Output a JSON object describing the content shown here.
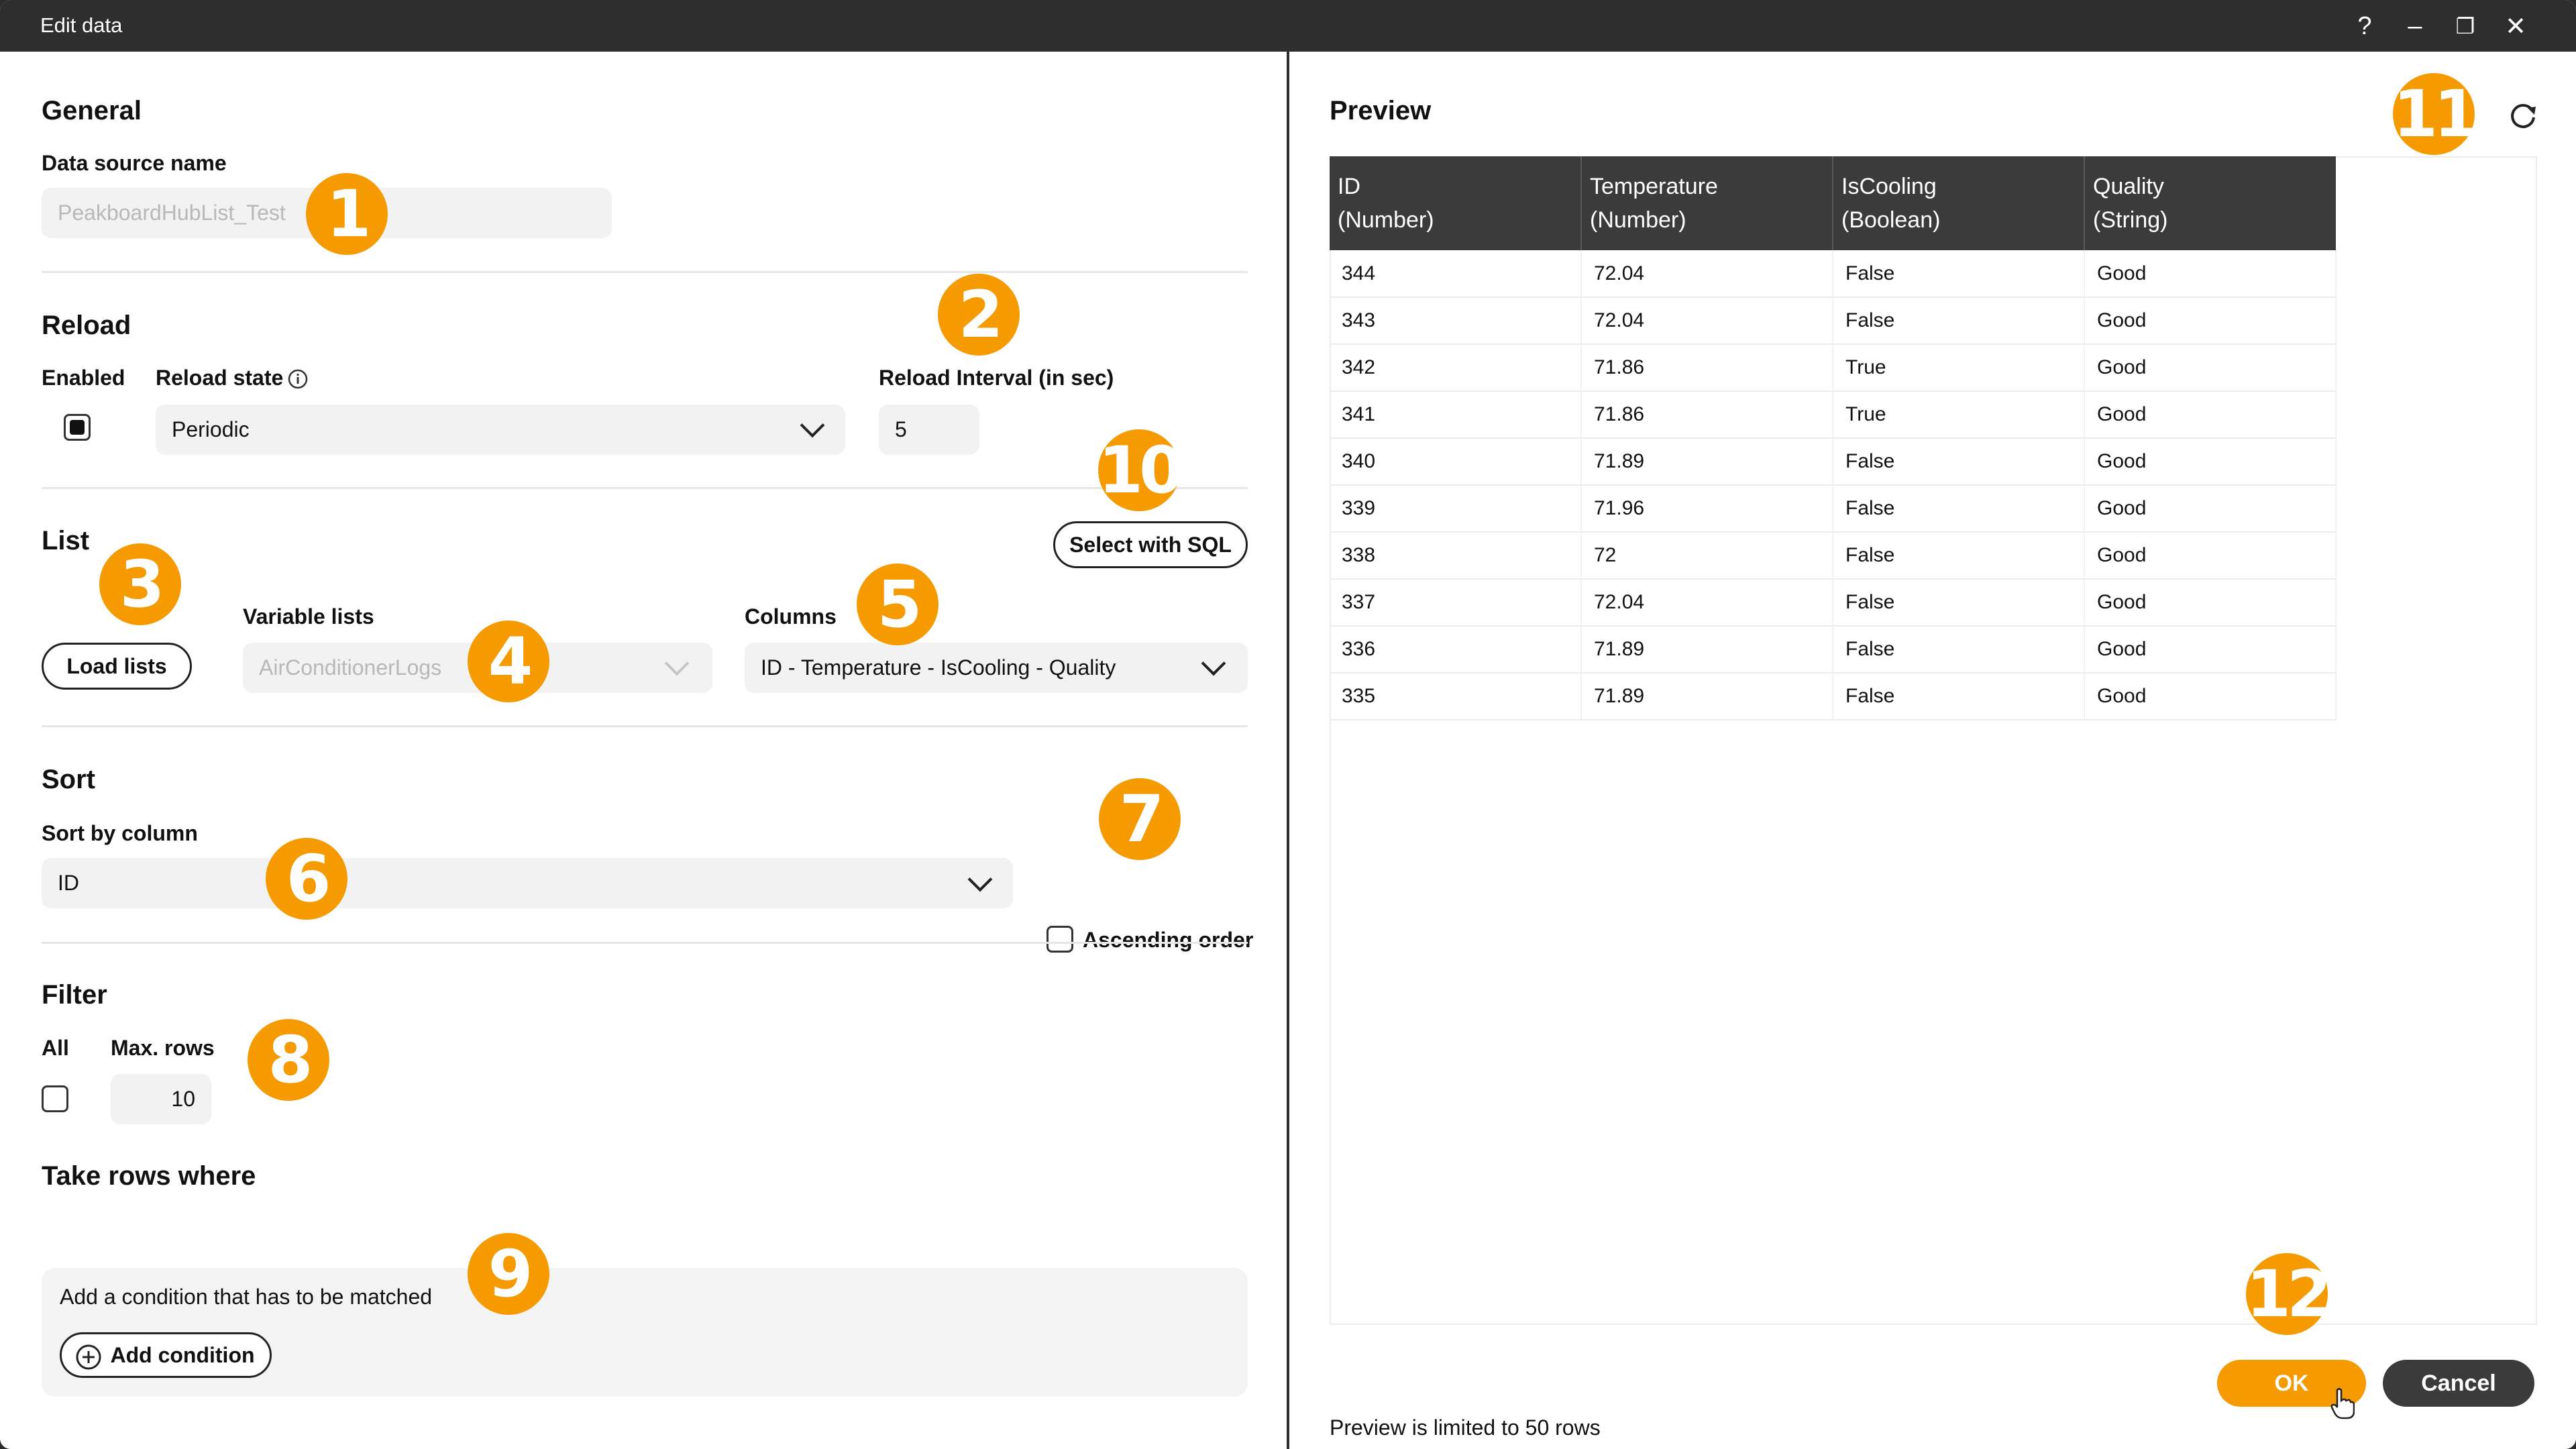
{
  "window": {
    "title": "Edit data",
    "controls": [
      "?",
      "–",
      "❐",
      "✕"
    ]
  },
  "general": {
    "heading": "General",
    "source_name_label": "Data source name",
    "source_name_value": "PeakboardHubList_Test"
  },
  "reload": {
    "heading": "Reload",
    "enabled_label": "Enabled",
    "enabled_checked": true,
    "state_label": "Reload state",
    "state_value": "Periodic",
    "interval_label": "Reload Interval (in sec)",
    "interval_value": "5"
  },
  "list": {
    "heading": "List",
    "select_sql_label": "Select with SQL",
    "load_lists_label": "Load lists",
    "variable_lists_label": "Variable lists",
    "variable_lists_value": "AirConditionerLogs",
    "columns_label": "Columns",
    "columns_value": "ID - Temperature - IsCooling - Quality"
  },
  "sort": {
    "heading": "Sort",
    "sort_by_label": "Sort by column",
    "sort_by_value": "ID",
    "ascending_label": "Ascending order",
    "ascending_checked": false
  },
  "filter": {
    "heading": "Filter",
    "all_label": "All",
    "all_checked": false,
    "max_rows_label": "Max. rows",
    "max_rows_value": "10"
  },
  "conditions": {
    "heading": "Take rows where",
    "hint": "Add a condition that has to be matched",
    "add_label": "Add condition"
  },
  "preview": {
    "heading": "Preview",
    "columns": [
      "ID\n(Number)",
      "Temperature\n(Number)",
      "IsCooling\n(Boolean)",
      "Quality\n(String)"
    ],
    "rows": [
      [
        "344",
        "72.04",
        "False",
        "Good"
      ],
      [
        "343",
        "72.04",
        "False",
        "Good"
      ],
      [
        "342",
        "71.86",
        "True",
        "Good"
      ],
      [
        "341",
        "71.86",
        "True",
        "Good"
      ],
      [
        "340",
        "71.89",
        "False",
        "Good"
      ],
      [
        "339",
        "71.96",
        "False",
        "Good"
      ],
      [
        "338",
        "72",
        "False",
        "Good"
      ],
      [
        "337",
        "72.04",
        "False",
        "Good"
      ],
      [
        "336",
        "71.89",
        "False",
        "Good"
      ],
      [
        "335",
        "71.89",
        "False",
        "Good"
      ]
    ],
    "limit_note": "Preview is limited to 50 rows"
  },
  "actions": {
    "ok_label": "OK",
    "cancel_label": "Cancel"
  },
  "badges": [
    "1",
    "2",
    "3",
    "4",
    "5",
    "6",
    "7",
    "8",
    "9",
    "10",
    "11",
    "12"
  ],
  "colors": {
    "accent": "#f59a00",
    "titlebar": "#2e2e2e",
    "table_header": "#3b3b3b"
  }
}
